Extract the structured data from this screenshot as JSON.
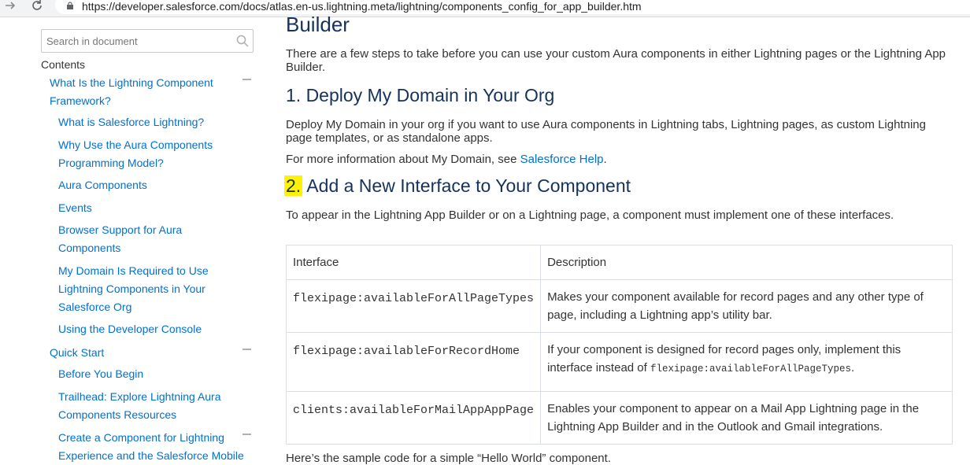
{
  "browser": {
    "url": "https://developer.salesforce.com/docs/atlas.en-us.lightning.meta/lightning/components_config_for_app_builder.htm",
    "forward_icon": "arrow-right-icon",
    "reload_icon": "reload-icon",
    "lock_icon": "lock-icon"
  },
  "sidebar": {
    "search_placeholder": "Search in document",
    "contents_label": "Contents",
    "toc": [
      {
        "label": "What Is the Lightning Component Framework?",
        "level": 1,
        "collapsible": true
      },
      {
        "label": "What is Salesforce Lightning?",
        "level": 2
      },
      {
        "label": "Why Use the Aura Components Programming Model?",
        "level": 2
      },
      {
        "label": "Aura Components",
        "level": 2
      },
      {
        "label": "Events",
        "level": 2
      },
      {
        "label": "Browser Support for Aura Components",
        "level": 2
      },
      {
        "label": "My Domain Is Required to Use Lightning Components in Your Salesforce Org",
        "level": 2
      },
      {
        "label": "Using the Developer Console",
        "level": 2
      },
      {
        "label": "Quick Start",
        "level": 1,
        "collapsible": true
      },
      {
        "label": "Before You Begin",
        "level": 2
      },
      {
        "label": "Trailhead: Explore Lightning Aura Components Resources",
        "level": 2
      },
      {
        "label": "Create a Component for Lightning Experience and the Salesforce Mobile",
        "level": 2,
        "collapsible": true
      }
    ]
  },
  "main": {
    "heading": "Builder",
    "intro": "There are a few steps to take before you can use your custom Aura components in either Lightning pages or the Lightning App Builder.",
    "section1": {
      "title": "1. Deploy My Domain in Your Org",
      "para": "Deploy My Domain in your org if you want to use Aura components in Lightning tabs, Lightning pages, as custom Lightning page templates, or as standalone apps.",
      "more_prefix": "For more information about My Domain, see ",
      "more_link": "Salesforce Help",
      "more_suffix": "."
    },
    "section2": {
      "number": "2.",
      "title": " Add a New Interface to Your Component",
      "para": "To appear in the Lightning App Builder or on a Lightning page, a component must implement one of these interfaces."
    },
    "table": {
      "headers": [
        "Interface",
        "Description"
      ],
      "rows": [
        {
          "iface": "flexipage:availableForAllPageTypes",
          "desc": "Makes your component available for record pages and any other type of page, including a Lightning app’s utility bar."
        },
        {
          "iface": "flexipage:availableForRecordHome",
          "desc_prefix": "If your component is designed for record pages only, implement this interface instead of ",
          "desc_code": "flexipage:availableForAllPageTypes",
          "desc_suffix": "."
        },
        {
          "iface": "clients:availableForMailAppAppPage",
          "desc": "Enables your component to appear on a Mail App Lightning page in the Lightning App Builder and in the Outlook and Gmail integrations."
        }
      ]
    },
    "cut_text": "Here’s the sample code for a simple “Hello World” component."
  }
}
